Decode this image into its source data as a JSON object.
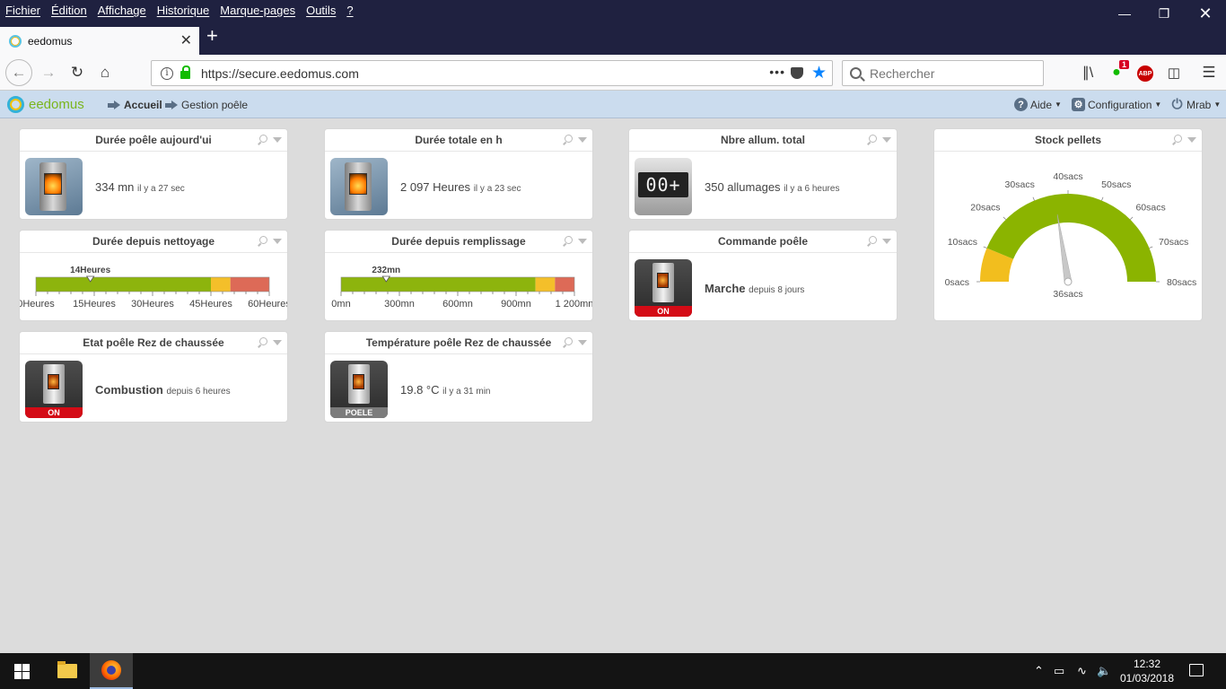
{
  "browser": {
    "menu": [
      "Fichier",
      "Édition",
      "Affichage",
      "Historique",
      "Marque-pages",
      "Outils",
      "?"
    ],
    "tab_title": "eedomus",
    "url": "https://secure.eedomus.com",
    "search_placeholder": "Rechercher",
    "notification_badge": "1",
    "abp_label": "ABP"
  },
  "app": {
    "logo_text": "eedomus",
    "breadcrumb": [
      "Accueil",
      "Gestion poêle"
    ],
    "help_label": "Aide",
    "config_label": "Configuration",
    "user_label": "Mrab"
  },
  "widgets": {
    "duree_aujourdhui": {
      "title": "Durée poêle aujourd'ui",
      "value": "334 mn",
      "since": "il y a 27 sec"
    },
    "duree_totale": {
      "title": "Durée totale en h",
      "value": "2 097 Heures",
      "since": "il y a 23 sec"
    },
    "nbre_allum": {
      "title": "Nbre allum. total",
      "value": "350 allumages",
      "since": "il y a 6 heures",
      "counter_display": "00+"
    },
    "stock_pellets": {
      "title": "Stock pellets",
      "unit": "sacs",
      "min": 0,
      "max": 80,
      "value": 36,
      "value_label": "36sacs",
      "ticks": [
        "0sacs",
        "10sacs",
        "20sacs",
        "30sacs",
        "40sacs",
        "50sacs",
        "60sacs",
        "70sacs",
        "80sacs"
      ],
      "bands": [
        {
          "from": 0,
          "to": 10,
          "color": "#f2be1e"
        },
        {
          "from": 10,
          "to": 80,
          "color": "#8bb400"
        }
      ]
    },
    "duree_nettoyage": {
      "title": "Durée depuis nettoyage",
      "marker_label": "14Heures",
      "min": 0,
      "max": 60,
      "value": 14,
      "ticks": [
        "0Heures",
        "15Heures",
        "30Heures",
        "45Heures",
        "60Heures"
      ],
      "bands": [
        {
          "from": 0,
          "to": 45,
          "color": "#8db40d"
        },
        {
          "from": 45,
          "to": 50,
          "color": "#f4bf2a"
        },
        {
          "from": 50,
          "to": 60,
          "color": "#dd6a57"
        }
      ]
    },
    "duree_remplissage": {
      "title": "Durée depuis remplissage",
      "marker_label": "232mn",
      "min": 0,
      "max": 1200,
      "value": 232,
      "ticks": [
        "0mn",
        "300mn",
        "600mn",
        "900mn",
        "1 200mn"
      ],
      "bands": [
        {
          "from": 0,
          "to": 1000,
          "color": "#8db40d"
        },
        {
          "from": 1000,
          "to": 1100,
          "color": "#f4bf2a"
        },
        {
          "from": 1100,
          "to": 1200,
          "color": "#dd6a57"
        }
      ]
    },
    "commande": {
      "title": "Commande poêle",
      "value": "Marche",
      "since": "depuis 8 jours",
      "badge": "ON"
    },
    "etat": {
      "title": "Etat poêle Rez de chaussée",
      "value": "Combustion",
      "since": "depuis 6 heures",
      "badge": "ON"
    },
    "temperature": {
      "title": "Température poêle Rez de chaussée",
      "value": "19.8 °C",
      "since": "il y a 31 min",
      "badge": "POELE"
    }
  },
  "taskbar": {
    "time": "12:32",
    "date": "01/03/2018"
  },
  "colors": {
    "header_bg": "#cbdcee",
    "accent_green": "#8bb400",
    "accent_yellow": "#f2be1e",
    "accent_red": "#dd6a57"
  }
}
